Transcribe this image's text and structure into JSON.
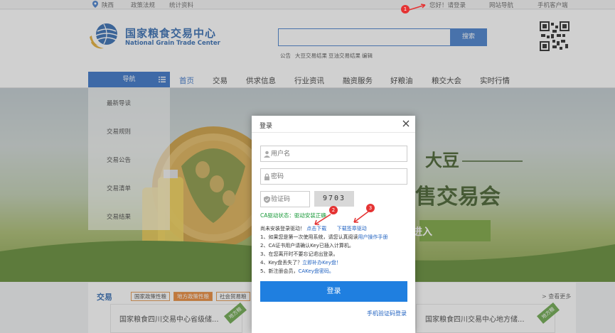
{
  "topbar": {
    "location": "陕西",
    "links": [
      "政策法规",
      "统计资料"
    ],
    "greeting": "您好！请登录",
    "nav_links": [
      "网站导航",
      "手机客户端"
    ]
  },
  "header": {
    "logo_cn": "国家粮食交易中心",
    "logo_en": "National Grain Trade Center",
    "search_button": "搜索",
    "hot_links": [
      "公告",
      "大豆交易结果",
      "豆油交易结果",
      "编辑"
    ]
  },
  "nav": {
    "head": "导航",
    "items": [
      "首页",
      "交易",
      "供求信息",
      "行业资讯",
      "融资服务",
      "好粮油",
      "粮交大会",
      "实时行情"
    ]
  },
  "sidebar": {
    "items": [
      "最新导读",
      "交易规则",
      "交易公告",
      "交易清单",
      "交易结果"
    ]
  },
  "banner": {
    "text_1": "大豆",
    "text_2": "售交易会",
    "cta": "进入"
  },
  "section": {
    "title": "交易",
    "tabs": [
      "国家政策性粮",
      "地方政策性粮",
      "社会贸易粮"
    ],
    "more": "> 查看更多",
    "cards": [
      {
        "text": "国家粮食四川交易中心省级储...",
        "badge": "地方粮"
      },
      {
        "text": "国家粮食四川交易中心地方储...",
        "badge": "地方粮"
      }
    ]
  },
  "modal": {
    "title": "登录",
    "username_placeholder": "用户名",
    "password_placeholder": "密码",
    "captcha_placeholder": "验证码",
    "captcha_code": "9703",
    "ca_status_label": "CA驱动状态：",
    "ca_status_value": "驱动安装正确",
    "notice_label": "尚未安装登录驱动！",
    "download_link": "点击下载",
    "sign_driver_link": "下载签章驱动",
    "tips": [
      {
        "num": "1、",
        "text": "如果您是第一次使用系统，请您认真阅读",
        "link": "用户操作手册"
      },
      {
        "num": "2、",
        "text": "CA证书用户请确认Key已插入计算机。",
        "link": ""
      },
      {
        "num": "3、",
        "text": "在您离开时不要忘记退出登录。",
        "link": ""
      },
      {
        "num": "4、",
        "text": "Key盘丢失了？",
        "link": "立即补办Key盘！"
      },
      {
        "num": "5、",
        "text": "新注册会员，",
        "link": "CAKey盘密码。"
      }
    ],
    "login_button": "登录",
    "sms_login_link": "手机验证码登录"
  },
  "markers": [
    "1",
    "2",
    "3"
  ],
  "colors": {
    "brand_blue": "#1f61c0",
    "login_blue": "#1f7fe0",
    "orange": "#e8781e",
    "marker_red": "#e53333"
  }
}
